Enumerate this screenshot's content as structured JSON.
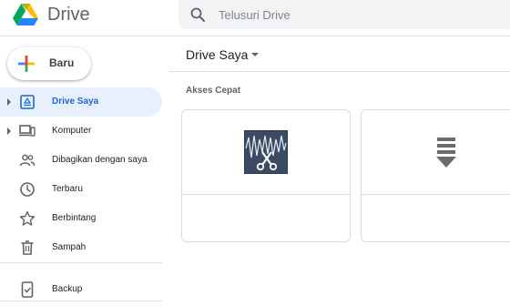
{
  "header": {
    "app_name": "Drive",
    "logo_icon": "google-drive-logo",
    "search": {
      "icon": "search-icon",
      "placeholder": "Telusuri Drive",
      "value": ""
    }
  },
  "sidebar": {
    "new_button": {
      "label": "Baru",
      "icon": "colorful-plus-icon"
    },
    "items": [
      {
        "label": "Drive Saya",
        "icon": "my-drive-icon",
        "expandable": true,
        "active": true
      },
      {
        "label": "Komputer",
        "icon": "computer-icon",
        "expandable": true,
        "active": false
      },
      {
        "label": "Dibagikan dengan saya",
        "icon": "shared-people-icon",
        "expandable": false,
        "active": false
      },
      {
        "label": "Terbaru",
        "icon": "clock-icon",
        "expandable": false,
        "active": false
      },
      {
        "label": "Berbintang",
        "icon": "star-icon",
        "expandable": false,
        "active": false
      },
      {
        "label": "Sampah",
        "icon": "trash-icon",
        "expandable": false,
        "active": false
      },
      {
        "label": "Backup",
        "icon": "backup-phone-icon",
        "expandable": false,
        "active": false
      }
    ]
  },
  "main": {
    "title": "Drive Saya",
    "quick_access": {
      "heading": "Akses Cepat",
      "files": [
        {
          "name": "",
          "thumbnail": "audio-cutter-icon"
        },
        {
          "name": "",
          "thumbnail": "download-arrow-icon"
        }
      ]
    }
  },
  "colors": {
    "accent": "#1967d2",
    "active_bg": "#e8f0fe",
    "search_bg": "#f1f3f4",
    "divider": "#e0e0e0",
    "text_primary": "#202124",
    "text_secondary": "#5f6368"
  }
}
